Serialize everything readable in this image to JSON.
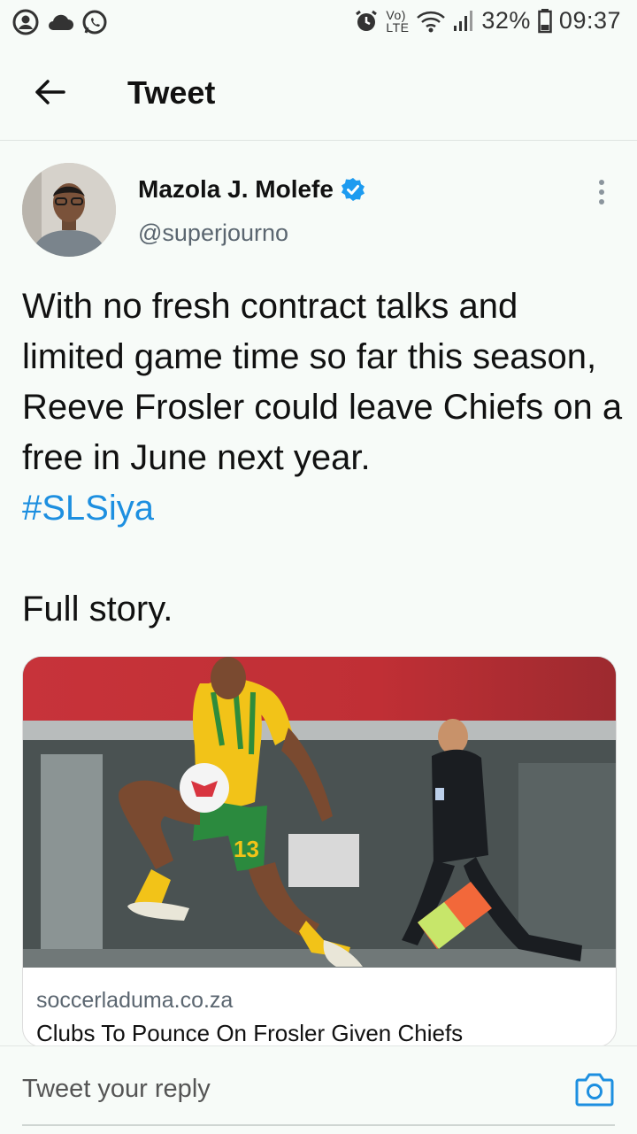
{
  "status_bar": {
    "signal_label": "Vo) LTE",
    "battery": "32%",
    "time": "09:37",
    "left_icons": [
      "account-circle-icon",
      "cloud-icon",
      "whatsapp-icon"
    ],
    "right_icons": [
      "alarm-icon",
      "wifi-icon",
      "signal-icon",
      "battery-icon"
    ]
  },
  "header": {
    "title": "Tweet"
  },
  "tweet": {
    "author_name": "Mazola J. Molefe",
    "handle": "@superjourno",
    "verified": true,
    "text_main": "With no fresh contract talks and limited game time so far this season, Reeve Frosler could leave Chiefs on a free in June next year.",
    "hashtag": "#SLSiya",
    "text_after": "Full story."
  },
  "link_card": {
    "domain": "soccerladuma.co.za",
    "title": "Clubs To Pounce On Frosler Given Chiefs",
    "player_number": "13"
  },
  "reply": {
    "placeholder": "Tweet your reply"
  },
  "colors": {
    "background": "#f7fbf8",
    "link_blue": "#1d8fe0",
    "verified_blue": "#1d9bf0"
  }
}
